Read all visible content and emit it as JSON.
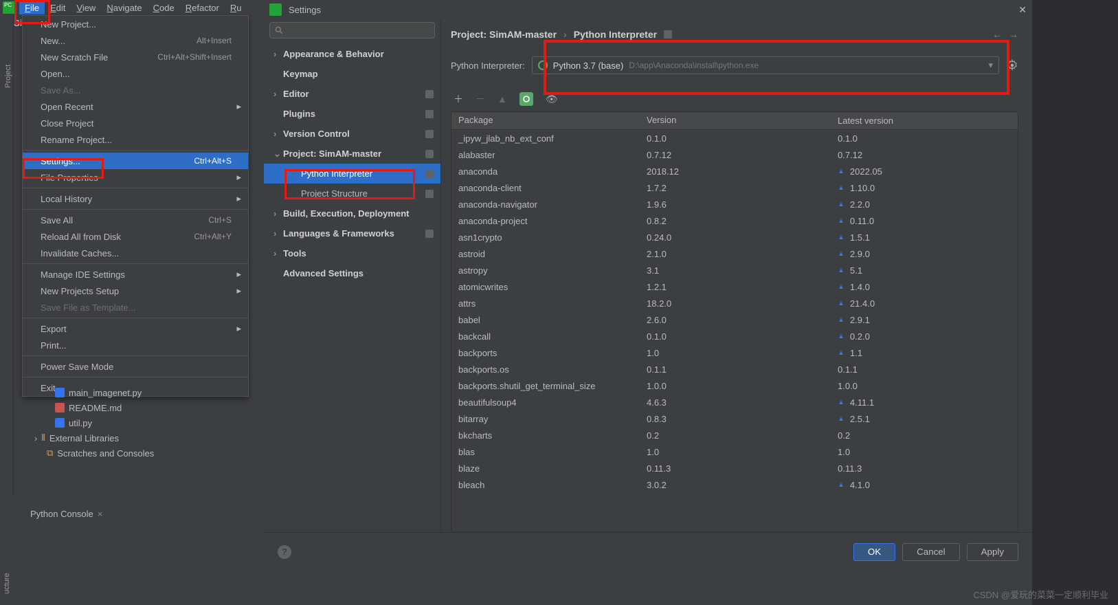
{
  "menubar": {
    "items": [
      "File",
      "Edit",
      "View",
      "Navigate",
      "Code",
      "Refactor",
      "Ru"
    ]
  },
  "file_menu": {
    "items": [
      {
        "label": "New Project..."
      },
      {
        "label": "New...",
        "shortcut": "Alt+Insert"
      },
      {
        "label": "New Scratch File",
        "shortcut": "Ctrl+Alt+Shift+Insert"
      },
      {
        "label": "Open...",
        "icon": "folder-open"
      },
      {
        "label": "Save As...",
        "disabled": true
      },
      {
        "label": "Open Recent",
        "sub": true
      },
      {
        "label": "Close Project"
      },
      {
        "label": "Rename Project..."
      },
      {
        "sep": true
      },
      {
        "label": "Settings...",
        "shortcut": "Ctrl+Alt+S",
        "icon": "gear",
        "selected": true
      },
      {
        "label": "File Properties",
        "sub": true
      },
      {
        "sep": true
      },
      {
        "label": "Local History",
        "sub": true
      },
      {
        "sep": true
      },
      {
        "label": "Save All",
        "shortcut": "Ctrl+S",
        "icon": "save"
      },
      {
        "label": "Reload All from Disk",
        "shortcut": "Ctrl+Alt+Y",
        "icon": "reload"
      },
      {
        "label": "Invalidate Caches..."
      },
      {
        "sep": true
      },
      {
        "label": "Manage IDE Settings",
        "sub": true
      },
      {
        "label": "New Projects Setup",
        "sub": true
      },
      {
        "label": "Save File as Template...",
        "disabled": true
      },
      {
        "sep": true
      },
      {
        "label": "Export",
        "sub": true
      },
      {
        "label": "Print...",
        "icon": "print"
      },
      {
        "sep": true
      },
      {
        "label": "Power Save Mode"
      },
      {
        "sep": true
      },
      {
        "label": "Exit"
      }
    ]
  },
  "side_labels": {
    "project": "Project",
    "structure": "ucture",
    "sin": "Sin"
  },
  "tree": {
    "files": [
      {
        "name": "main_imagenet.py",
        "kind": "py"
      },
      {
        "name": "README.md",
        "kind": "md"
      },
      {
        "name": "util.py",
        "kind": "py"
      }
    ],
    "external": "External Libraries",
    "scratches": "Scratches and Consoles"
  },
  "bottom_tab": {
    "label": "Python Console"
  },
  "settings": {
    "title": "Settings",
    "nav": [
      {
        "label": "Appearance & Behavior",
        "exp": ">",
        "bold": true
      },
      {
        "label": "Keymap",
        "bold": true
      },
      {
        "label": "Editor",
        "exp": ">",
        "bold": true,
        "badge": true
      },
      {
        "label": "Plugins",
        "bold": true,
        "badge": true
      },
      {
        "label": "Version Control",
        "exp": ">",
        "bold": true,
        "badge": true
      },
      {
        "label": "Project: SimAM-master",
        "exp": "v",
        "bold": true,
        "badge": true
      },
      {
        "label": "Python Interpreter",
        "sub": true,
        "selected": true,
        "badge": true
      },
      {
        "label": "Project Structure",
        "sub": true,
        "badge": true
      },
      {
        "label": "Build, Execution, Deployment",
        "exp": ">",
        "bold": true
      },
      {
        "label": "Languages & Frameworks",
        "exp": ">",
        "bold": true,
        "badge": true
      },
      {
        "label": "Tools",
        "exp": ">",
        "bold": true
      },
      {
        "label": "Advanced Settings",
        "bold": true
      }
    ],
    "breadcrumb": {
      "root": "Project: SimAM-master",
      "current": "Python Interpreter"
    },
    "interpreter": {
      "label": "Python Interpreter:",
      "name": "Python 3.7 (base)",
      "path": "D:\\app\\Anaconda\\install\\python.exe"
    },
    "packages_header": {
      "col1": "Package",
      "col2": "Version",
      "col3": "Latest version"
    },
    "packages": [
      {
        "n": "_ipyw_jlab_nb_ext_conf",
        "v": "0.1.0",
        "l": "0.1.0"
      },
      {
        "n": "alabaster",
        "v": "0.7.12",
        "l": "0.7.12"
      },
      {
        "n": "anaconda",
        "v": "2018.12",
        "l": "2022.05",
        "u": true
      },
      {
        "n": "anaconda-client",
        "v": "1.7.2",
        "l": "1.10.0",
        "u": true
      },
      {
        "n": "anaconda-navigator",
        "v": "1.9.6",
        "l": "2.2.0",
        "u": true
      },
      {
        "n": "anaconda-project",
        "v": "0.8.2",
        "l": "0.11.0",
        "u": true
      },
      {
        "n": "asn1crypto",
        "v": "0.24.0",
        "l": "1.5.1",
        "u": true
      },
      {
        "n": "astroid",
        "v": "2.1.0",
        "l": "2.9.0",
        "u": true
      },
      {
        "n": "astropy",
        "v": "3.1",
        "l": "5.1",
        "u": true
      },
      {
        "n": "atomicwrites",
        "v": "1.2.1",
        "l": "1.4.0",
        "u": true
      },
      {
        "n": "attrs",
        "v": "18.2.0",
        "l": "21.4.0",
        "u": true
      },
      {
        "n": "babel",
        "v": "2.6.0",
        "l": "2.9.1",
        "u": true
      },
      {
        "n": "backcall",
        "v": "0.1.0",
        "l": "0.2.0",
        "u": true
      },
      {
        "n": "backports",
        "v": "1.0",
        "l": "1.1",
        "u": true
      },
      {
        "n": "backports.os",
        "v": "0.1.1",
        "l": "0.1.1"
      },
      {
        "n": "backports.shutil_get_terminal_size",
        "v": "1.0.0",
        "l": "1.0.0"
      },
      {
        "n": "beautifulsoup4",
        "v": "4.6.3",
        "l": "4.11.1",
        "u": true
      },
      {
        "n": "bitarray",
        "v": "0.8.3",
        "l": "2.5.1",
        "u": true
      },
      {
        "n": "bkcharts",
        "v": "0.2",
        "l": "0.2"
      },
      {
        "n": "blas",
        "v": "1.0",
        "l": "1.0"
      },
      {
        "n": "blaze",
        "v": "0.11.3",
        "l": "0.11.3"
      },
      {
        "n": "bleach",
        "v": "3.0.2",
        "l": "4.1.0",
        "u": true
      }
    ],
    "buttons": {
      "ok": "OK",
      "cancel": "Cancel",
      "apply": "Apply"
    }
  },
  "watermark": "CSDN @爱玩的菜菜一定顺利毕业"
}
